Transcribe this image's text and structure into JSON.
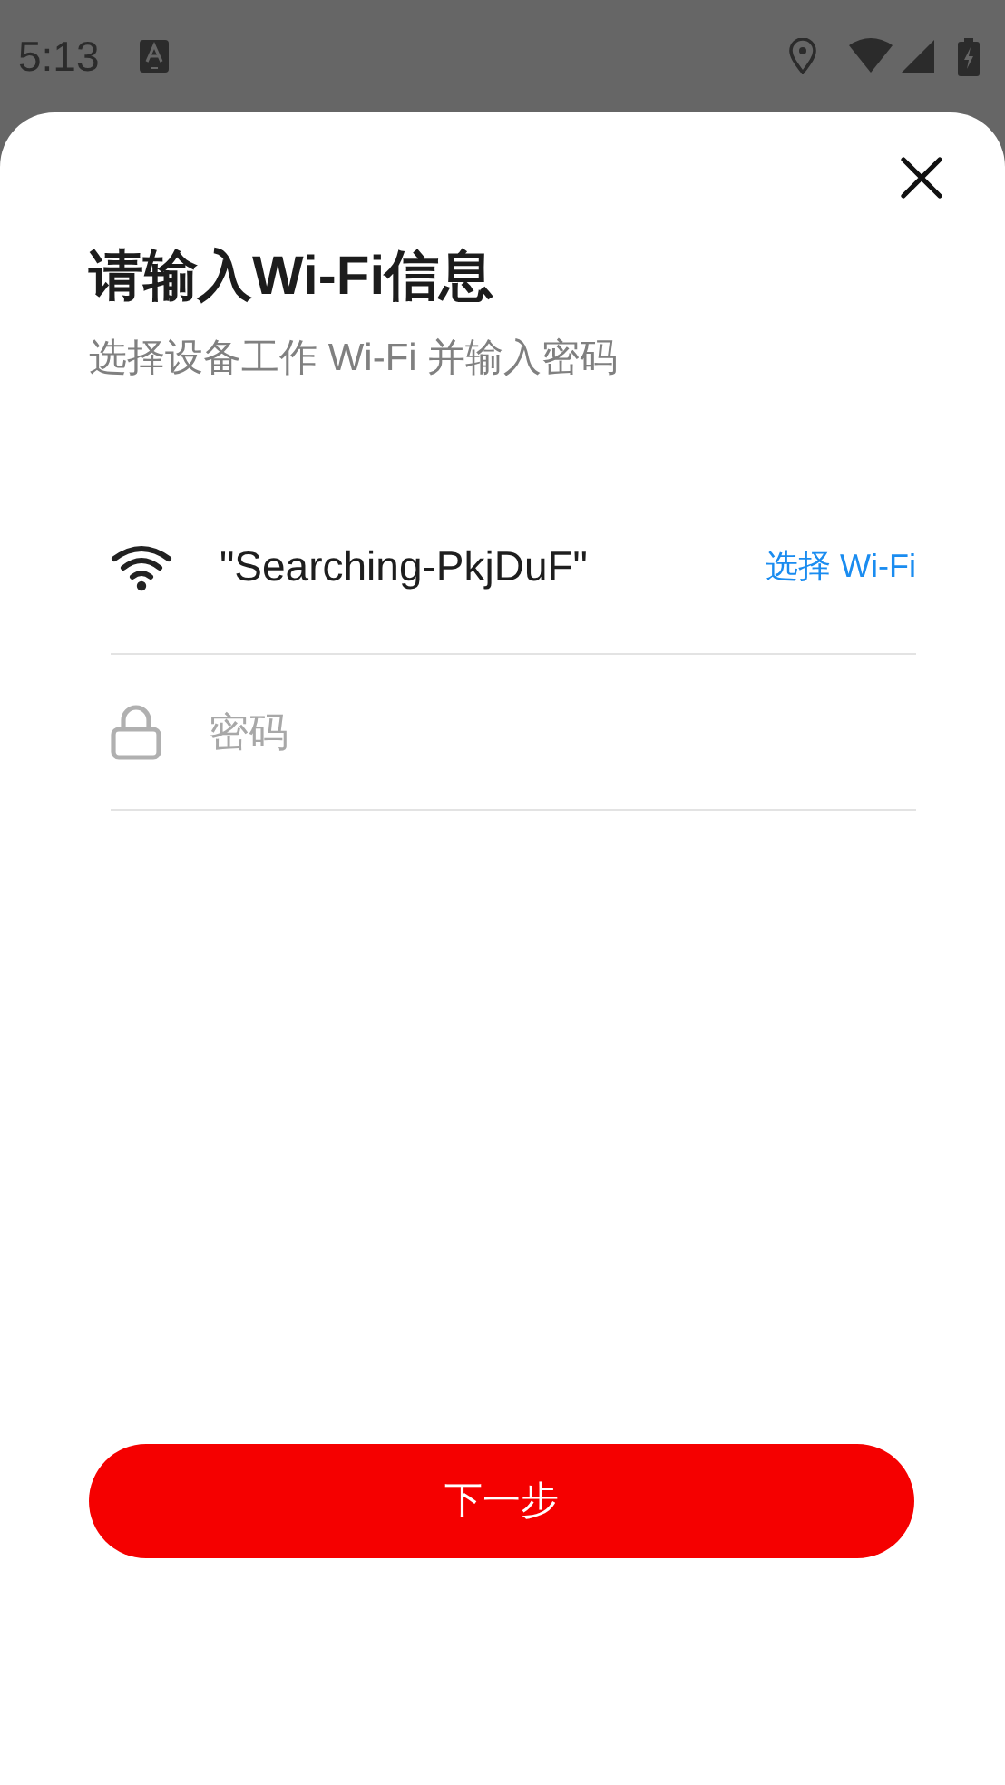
{
  "status_bar": {
    "time": "5:13"
  },
  "dialog": {
    "title": "请输入Wi-Fi信息",
    "subtitle": "选择设备工作 Wi-Fi 并输入密码",
    "wifi_name": "\"Searching-PkjDuF\"",
    "choose_wifi": "选择 Wi-Fi",
    "password": {
      "placeholder": "密码"
    },
    "next_button": "下一步"
  }
}
